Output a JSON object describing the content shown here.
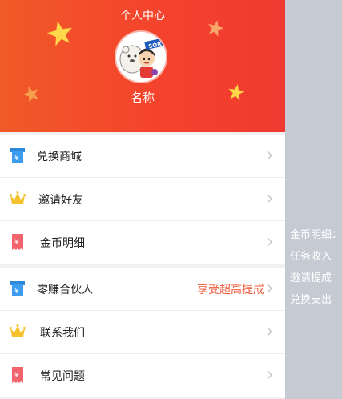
{
  "header": {
    "title": "个人中心",
    "username": "名称"
  },
  "menu": [
    {
      "label": "兑换商城",
      "icon": "ticket-icon",
      "extra": ""
    },
    {
      "label": "邀请好友",
      "icon": "crown-icon",
      "extra": ""
    },
    {
      "label": "金币明细",
      "icon": "receipt-icon",
      "extra": ""
    },
    {
      "label": "零赚合伙人",
      "icon": "ticket-icon",
      "extra": "享受超高提成"
    },
    {
      "label": "联系我们",
      "icon": "crown-icon",
      "extra": ""
    },
    {
      "label": "常见问题",
      "icon": "receipt-icon",
      "extra": ""
    }
  ],
  "side_panel": {
    "title": "金币明细：",
    "items": [
      "任务收入",
      "邀请提成",
      "兑换支出"
    ]
  },
  "colors": {
    "header": "#f4432c",
    "accent": "#ef5a3c",
    "star": "#ffd84a"
  }
}
